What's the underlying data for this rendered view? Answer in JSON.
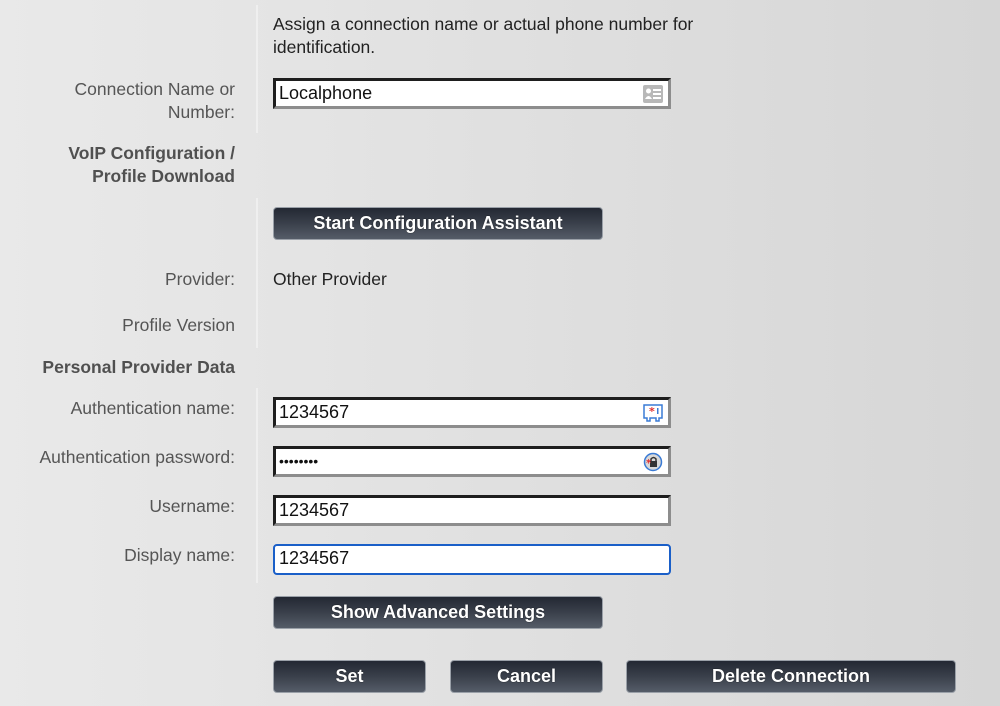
{
  "intro": {
    "line1": "Assign a connection name or actual phone number for",
    "line2": "identification."
  },
  "connection": {
    "label_line1": "Connection Name or",
    "label_line2": "Number:",
    "value": "Localphone",
    "icon": "contact-card-icon"
  },
  "voip_section": {
    "heading_line1": "VoIP Configuration /",
    "heading_line2": "Profile Download",
    "start_button": "Start Configuration Assistant"
  },
  "provider": {
    "label": "Provider:",
    "value": "Other Provider"
  },
  "profile_version": {
    "label": "Profile Version",
    "value": ""
  },
  "personal_section": {
    "heading": "Personal Provider Data",
    "auth_name": {
      "label": "Authentication name:",
      "value": "1234567",
      "icon": "password-manager-key-icon"
    },
    "auth_password": {
      "label": "Authentication password:",
      "value": "••••••••",
      "icon": "password-manager-lock-icon"
    },
    "username": {
      "label": "Username:",
      "value": "1234567"
    },
    "display_name": {
      "label": "Display name:",
      "value": "1234567"
    }
  },
  "buttons": {
    "advanced": "Show Advanced Settings",
    "set": "Set",
    "cancel": "Cancel",
    "delete": "Delete Connection"
  },
  "colors": {
    "button_dark": "#2e3440",
    "focus_ring": "#1a5fc8",
    "icon_red": "#e03030",
    "icon_blue": "#3a7bd5"
  }
}
